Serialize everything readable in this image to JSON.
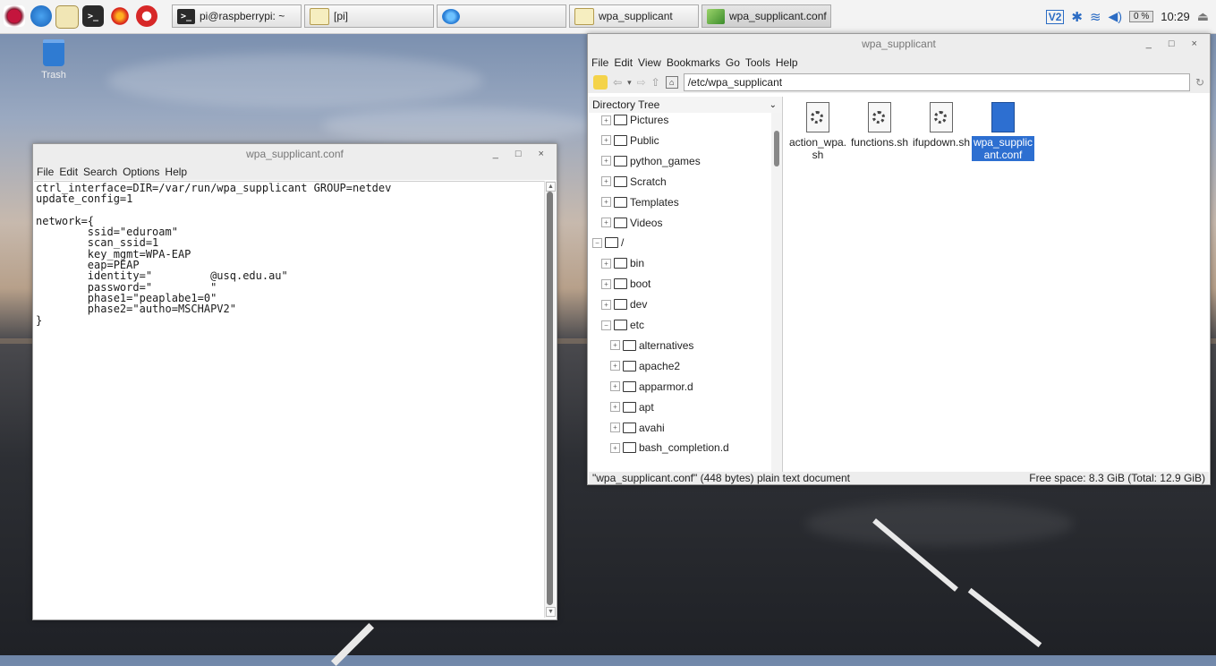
{
  "taskbar": {
    "terminal_task": "pi@raspberrypi: ~",
    "folder_task": "[pi]",
    "fm_task": "wpa_supplicant",
    "editor_task": "wpa_supplicant.conf",
    "cpu_text": "0 %",
    "clock": "10:29"
  },
  "trash": {
    "label": "Trash"
  },
  "editor": {
    "title": "wpa_supplicant.conf",
    "controls": "_ □ ×",
    "menu": [
      "File",
      "Edit",
      "Search",
      "Options",
      "Help"
    ],
    "content": "ctrl_interface=DIR=/var/run/wpa_supplicant GROUP=netdev\nupdate_config=1\n\nnetwork={\n        ssid=\"eduroam\"\n        scan_ssid=1\n        key_mgmt=WPA-EAP\n        eap=PEAP\n        identity=\"         @usq.edu.au\"\n        password=\"         \"\n        phase1=\"peaplabe1=0\"\n        phase2=\"autho=MSCHAPV2\"\n}"
  },
  "filemanager": {
    "title": "wpa_supplicant",
    "controls": "_ □ ×",
    "menu": [
      "File",
      "Edit",
      "View",
      "Bookmarks",
      "Go",
      "Tools",
      "Help"
    ],
    "address": "/etc/wpa_supplicant",
    "tree_header": "Directory Tree",
    "tree": [
      {
        "label": "Pictures",
        "indent": 1,
        "exp": "+"
      },
      {
        "label": "Public",
        "indent": 1,
        "exp": "+"
      },
      {
        "label": "python_games",
        "indent": 1,
        "exp": "+"
      },
      {
        "label": "Scratch",
        "indent": 1,
        "exp": "+"
      },
      {
        "label": "Templates",
        "indent": 1,
        "exp": "+"
      },
      {
        "label": "Videos",
        "indent": 1,
        "exp": "+"
      },
      {
        "label": "/",
        "indent": 0,
        "exp": "−"
      },
      {
        "label": "bin",
        "indent": 1,
        "exp": "+"
      },
      {
        "label": "boot",
        "indent": 1,
        "exp": "+"
      },
      {
        "label": "dev",
        "indent": 1,
        "exp": "+"
      },
      {
        "label": "etc",
        "indent": 1,
        "exp": "−"
      },
      {
        "label": "alternatives",
        "indent": 2,
        "exp": "+"
      },
      {
        "label": "apache2",
        "indent": 2,
        "exp": "+"
      },
      {
        "label": "apparmor.d",
        "indent": 2,
        "exp": "+"
      },
      {
        "label": "apt",
        "indent": 2,
        "exp": "+"
      },
      {
        "label": "avahi",
        "indent": 2,
        "exp": "+"
      },
      {
        "label": "bash_completion.d",
        "indent": 2,
        "exp": "+"
      }
    ],
    "files": [
      {
        "name": "action_wpa.\nsh",
        "selected": false
      },
      {
        "name": "functions.sh",
        "selected": false
      },
      {
        "name": "ifupdown.sh",
        "selected": false
      },
      {
        "name": "wpa_supplic\nant.conf",
        "selected": true
      }
    ],
    "status_left": "\"wpa_supplicant.conf\" (448 bytes) plain text document",
    "status_right": "Free space: 8.3 GiB (Total: 12.9 GiB)"
  },
  "colors": {
    "selection": "#2d6fd1",
    "panel": "#f3f3f3"
  }
}
